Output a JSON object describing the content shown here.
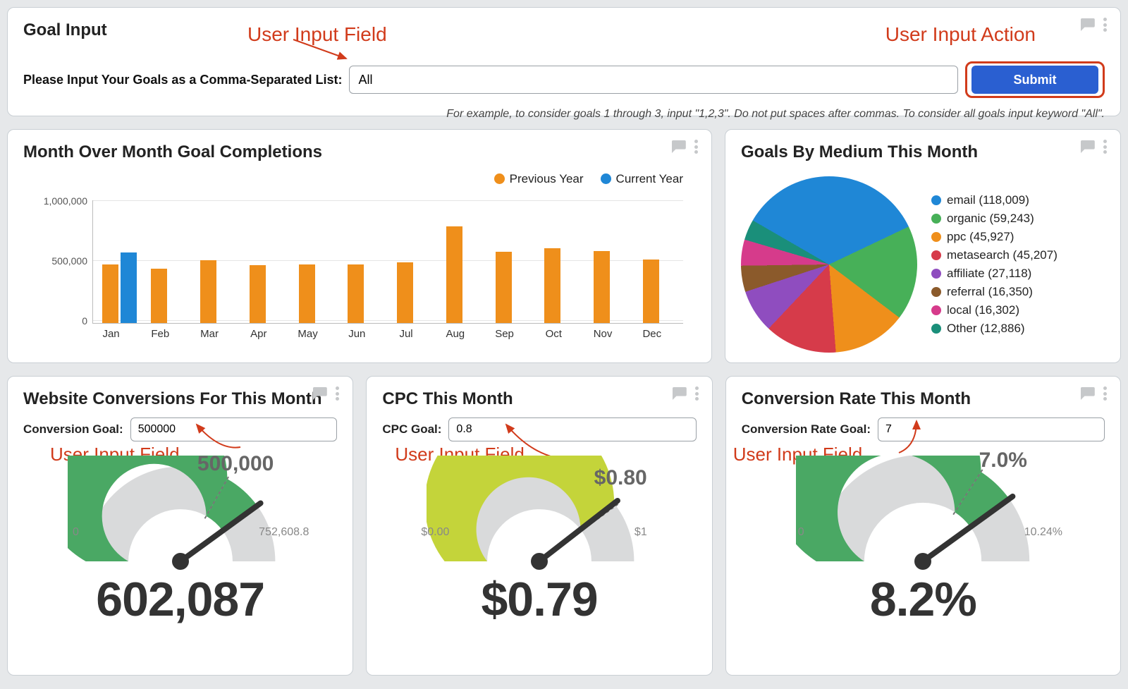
{
  "goal_input": {
    "title": "Goal Input",
    "label": "Please Input Your Goals as a Comma-Separated List:",
    "value": "All",
    "submit": "Submit",
    "help": "For example, to consider goals 1 through 3, input \"1,2,3\". Do not put spaces after commas. To consider all goals input keyword \"All\"."
  },
  "annotations": {
    "input_field": "User Input Field",
    "input_action": "User Input Action"
  },
  "mom_panel": {
    "title": "Month Over Month Goal Completions",
    "legend_prev": "Previous Year",
    "legend_cur": "Current Year"
  },
  "medium_panel": {
    "title": "Goals By Medium This Month"
  },
  "conv_panel": {
    "title": "Website Conversions For This Month",
    "goal_label": "Conversion Goal:",
    "goal_value": "500000",
    "min": "0",
    "max": "752,608.8",
    "goal": "500,000",
    "value": "602,087"
  },
  "cpc_panel": {
    "title": "CPC This Month",
    "goal_label": "CPC Goal:",
    "goal_value": "0.8",
    "min": "$0.00",
    "max": "$1",
    "goal": "$0.80",
    "value": "$0.79"
  },
  "rate_panel": {
    "title": "Conversion Rate This Month",
    "goal_label": "Conversion Rate Goal:",
    "goal_value": "7",
    "min": "0",
    "max": "10.24%",
    "goal": "7.0%",
    "value": "8.2%"
  },
  "chart_data": [
    {
      "type": "bar",
      "title": "Month Over Month Goal Completions",
      "categories": [
        "Jan",
        "Feb",
        "Mar",
        "Apr",
        "May",
        "Jun",
        "Jul",
        "Aug",
        "Sep",
        "Oct",
        "Nov",
        "Dec"
      ],
      "series": [
        {
          "name": "Previous Year",
          "color": "#ef8f1b",
          "values": [
            490000,
            455000,
            525000,
            480000,
            490000,
            490000,
            505000,
            805000,
            595000,
            625000,
            600000,
            530000
          ]
        },
        {
          "name": "Current Year",
          "color": "#1f87d6",
          "values": [
            590000,
            null,
            null,
            null,
            null,
            null,
            null,
            null,
            null,
            null,
            null,
            null
          ]
        }
      ],
      "ylabel": "",
      "ylim": [
        0,
        1000000
      ],
      "yticks": [
        0,
        500000,
        1000000
      ],
      "ytick_labels": [
        "0",
        "500,000",
        "1,000,000"
      ]
    },
    {
      "type": "pie",
      "title": "Goals By Medium This Month",
      "slices": [
        {
          "label": "email",
          "value": 118009,
          "color": "#1f87d6"
        },
        {
          "label": "organic",
          "value": 59243,
          "color": "#47b058"
        },
        {
          "label": "ppc",
          "value": 45927,
          "color": "#ef8f1b"
        },
        {
          "label": "metasearch",
          "value": 45207,
          "color": "#d63b4a"
        },
        {
          "label": "affiliate",
          "value": 27118,
          "color": "#8f4dbf"
        },
        {
          "label": "referral",
          "value": 16350,
          "color": "#8b5a2b"
        },
        {
          "label": "local",
          "value": 16302,
          "color": "#d63b8b"
        },
        {
          "label": "Other",
          "value": 12886,
          "color": "#1a8f7a"
        }
      ]
    },
    {
      "type": "gauge",
      "title": "Website Conversions For This Month",
      "min": 0,
      "max": 752608.8,
      "goal": 500000,
      "value": 602087,
      "fill_color": "#4aa864"
    },
    {
      "type": "gauge",
      "title": "CPC This Month",
      "min": 0.0,
      "max": 1.0,
      "goal": 0.8,
      "value": 0.79,
      "fill_color": "#c4d43a"
    },
    {
      "type": "gauge",
      "title": "Conversion Rate This Month",
      "min": 0,
      "max": 10.24,
      "goal": 7.0,
      "value": 8.2,
      "fill_color": "#4aa864"
    }
  ]
}
